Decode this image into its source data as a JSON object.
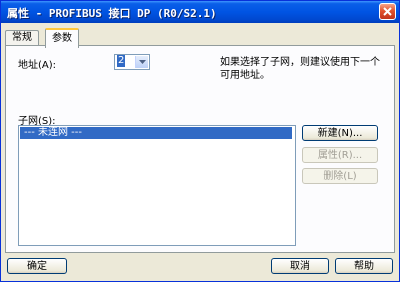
{
  "window": {
    "title": "属性 - PROFIBUS 接口  DP (R0/S2.1)"
  },
  "tabs": [
    {
      "label": "常规"
    },
    {
      "label": "参数"
    }
  ],
  "address": {
    "label": "地址(A):",
    "value": "2"
  },
  "hint": "如果选择了子网，则建议使用下一个可用地址。",
  "subnet": {
    "label": "子网(S):",
    "items": [
      "--- 未连网 ---"
    ]
  },
  "side_buttons": {
    "new": "新建(N)...",
    "properties": "属性(R)...",
    "delete": "删除(L)"
  },
  "footer": {
    "ok": "确定",
    "cancel": "取消",
    "help": "帮助"
  }
}
